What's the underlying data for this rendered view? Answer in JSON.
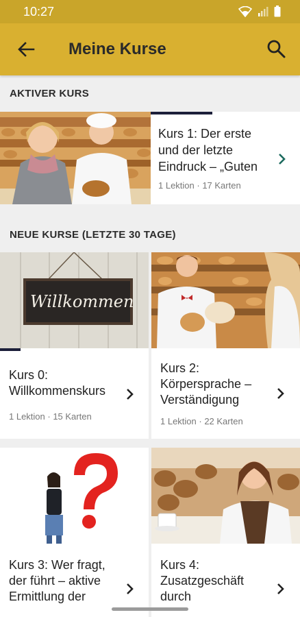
{
  "status": {
    "time": "10:27"
  },
  "appbar": {
    "title": "Meine Kurse"
  },
  "sections": {
    "active": "AKTIVER KURS",
    "new": "NEUE KURSE (LETZTE 30 TAGE)"
  },
  "active_course": {
    "title": "Kurs 1: Der erste und der letzte Eindruck – „Guten",
    "meta": "1 Lektion · 17 Karten"
  },
  "courses": [
    {
      "title": "Kurs 0: Willkommenskurs",
      "meta": "1 Lektion · 15 Karten",
      "image_text": "Willkommen"
    },
    {
      "title": "Kurs 2: Körpersprache – Verständigung",
      "meta": "1 Lektion · 22 Karten"
    },
    {
      "title": "Kurs 3: Wer fragt, der führt – aktive Ermittlung der",
      "meta": ""
    },
    {
      "title": "Kurs 4: Zusatzgeschäft durch",
      "meta": ""
    }
  ],
  "colors": {
    "appbar": "#d9b030",
    "statusbar": "#c9a52a",
    "accent": "#1c6a5e",
    "progress": "#1c1f3a"
  }
}
